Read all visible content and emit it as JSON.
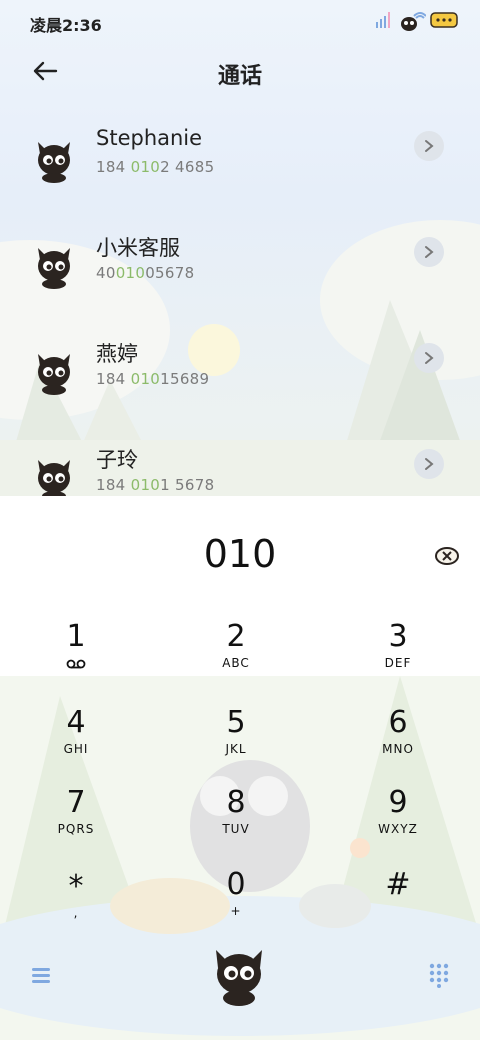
{
  "status_bar": {
    "time": "凌晨2:36",
    "icons": [
      "signal-icon",
      "wifi-cat-icon",
      "battery-icon"
    ]
  },
  "header": {
    "title": "通话",
    "back_icon": "back-arrow-icon"
  },
  "contacts": [
    {
      "name": "Stephanie",
      "num_pre": "184 ",
      "num_hl": "010",
      "num_post": "2 4685"
    },
    {
      "name": "小米客服",
      "num_pre": "40",
      "num_hl": "010",
      "num_post": "05678"
    },
    {
      "name": "燕婷",
      "num_pre": "184 ",
      "num_hl": "010",
      "num_post": "15689"
    },
    {
      "name": "子玲",
      "num_pre": "184 ",
      "num_hl": "010",
      "num_post": "1 5678"
    }
  ],
  "dialer": {
    "input": "010",
    "keys": [
      {
        "digit": "1",
        "letters": ""
      },
      {
        "digit": "2",
        "letters": "ABC"
      },
      {
        "digit": "3",
        "letters": "DEF"
      },
      {
        "digit": "4",
        "letters": "GHI"
      },
      {
        "digit": "5",
        "letters": "JKL"
      },
      {
        "digit": "6",
        "letters": "MNO"
      },
      {
        "digit": "7",
        "letters": "PQRS"
      },
      {
        "digit": "8",
        "letters": "TUV"
      },
      {
        "digit": "9",
        "letters": "WXYZ"
      },
      {
        "digit": "*",
        "letters": ","
      },
      {
        "digit": "0",
        "letters": "+"
      },
      {
        "digit": "#",
        "letters": ""
      }
    ]
  },
  "colors": {
    "highlight": "#8cbb6a",
    "number_gray": "#7b7b7b",
    "accent_blue": "#7fa8e0"
  }
}
